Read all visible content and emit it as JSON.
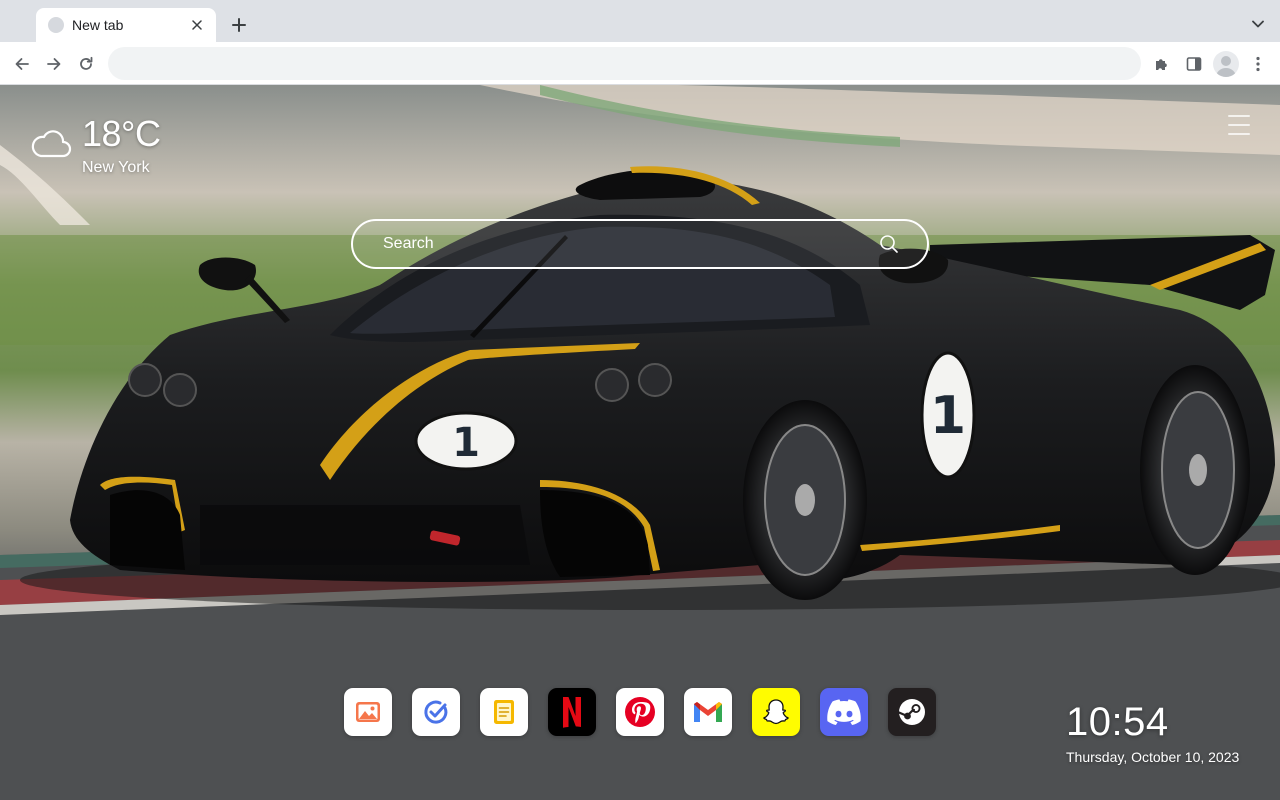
{
  "browser": {
    "tab": {
      "title": "New tab"
    },
    "omnibox": {
      "value": "",
      "placeholder": ""
    },
    "icons": {
      "tab_close": "close-icon",
      "new_tab": "plus-icon",
      "tab_search": "chevron-down-icon",
      "back": "arrow-left-icon",
      "forward": "arrow-right-icon",
      "reload": "reload-icon",
      "extensions": "puzzle-icon",
      "side_panel": "side-panel-icon",
      "profile": "avatar-icon",
      "more": "kebab-menu-icon"
    }
  },
  "weather": {
    "temperature": "18°C",
    "city": "New York",
    "icon": "cloud-icon"
  },
  "search": {
    "placeholder": "Search",
    "icon": "search-icon"
  },
  "dock": {
    "apps": [
      {
        "name": "Photos",
        "icon": "photos-icon",
        "bg": "#ffffff",
        "accent": "#f26b3a"
      },
      {
        "name": "Tasks",
        "icon": "check-circle-icon",
        "bg": "#ffffff",
        "accent": "#4a73e8"
      },
      {
        "name": "Notes",
        "icon": "notes-icon",
        "bg": "#ffffff",
        "accent": "#f5b800"
      },
      {
        "name": "Netflix",
        "icon": "netflix-icon",
        "bg": "#000000",
        "accent": "#e50914"
      },
      {
        "name": "Pinterest",
        "icon": "pinterest-icon",
        "bg": "#ffffff",
        "accent": "#e60023"
      },
      {
        "name": "Gmail",
        "icon": "gmail-icon",
        "bg": "#ffffff",
        "accent": "#ea4335"
      },
      {
        "name": "Snapchat",
        "icon": "snapchat-icon",
        "bg": "#fffc00",
        "accent": "#ffffff"
      },
      {
        "name": "Discord",
        "icon": "discord-icon",
        "bg": "#5865f2",
        "accent": "#ffffff"
      },
      {
        "name": "Steam",
        "icon": "steam-icon",
        "bg": "#231f20",
        "accent": "#ffffff"
      }
    ]
  },
  "clock": {
    "time": "10:54",
    "date": "Thursday, October 10, 2023"
  },
  "menu": {
    "icon": "hamburger-menu-icon"
  },
  "colors": {
    "tabstrip": "#dee1e6",
    "toolbar": "#ffffff",
    "omnibox": "#f1f3f4",
    "text_light": "#ffffff"
  }
}
